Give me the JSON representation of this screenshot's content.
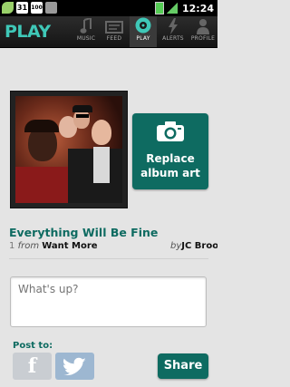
{
  "status_bar": {
    "calendar_day": "31",
    "box_label": "100",
    "time": "12:24"
  },
  "nav": {
    "brand": "PLAY",
    "tabs": [
      {
        "label": "MUSIC",
        "icon": "music-note-icon"
      },
      {
        "label": "FEED",
        "icon": "feed-icon"
      },
      {
        "label": "PLAY",
        "icon": "play-disc-icon"
      },
      {
        "label": "ALERTS",
        "icon": "lightning-icon"
      },
      {
        "label": "PROFILE",
        "icon": "profile-icon"
      }
    ],
    "active_tab": "PLAY"
  },
  "album_art": {
    "icon": "album-cover-image"
  },
  "replace_button": {
    "line1": "Replace",
    "line2": "album art",
    "icon": "camera-icon"
  },
  "track": {
    "title": "Everything Will Be Fine",
    "track_number": "1",
    "from_label": "from",
    "album": "Want More",
    "by_label": "by",
    "artist": "JC Broo"
  },
  "message": {
    "placeholder": "What's up?"
  },
  "post": {
    "label": "Post to:",
    "services": [
      {
        "name": "facebook",
        "glyph": "f",
        "icon": "facebook-icon"
      },
      {
        "name": "twitter",
        "icon": "twitter-bird-icon"
      }
    ],
    "share_label": "Share"
  },
  "colors": {
    "accent": "#0e6b61",
    "brand": "#3fc8b8",
    "background": "#e4e4e4"
  }
}
